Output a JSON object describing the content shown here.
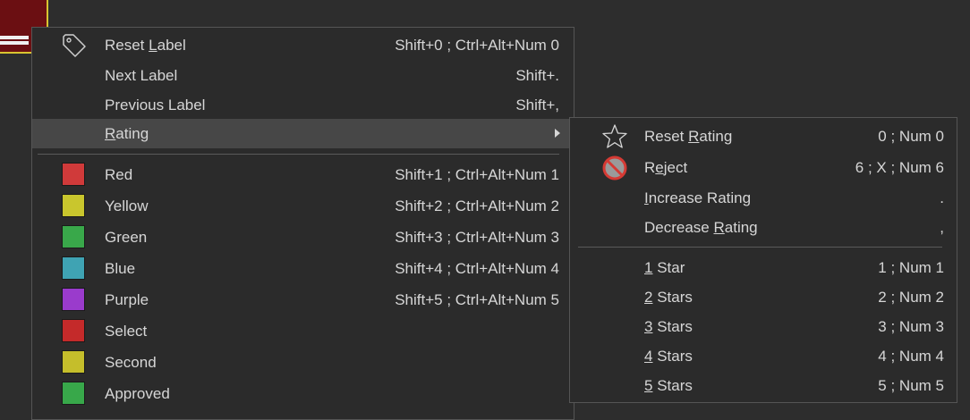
{
  "main_menu": {
    "items": [
      {
        "id": "reset-label",
        "pre": "Reset ",
        "u": "L",
        "post": "abel",
        "shortcut": "Shift+0 ; Ctrl+Alt+Num 0",
        "icon": "tag-icon"
      },
      {
        "id": "next-label",
        "pre": "Next Label",
        "u": "",
        "post": "",
        "shortcut": "Shift+."
      },
      {
        "id": "previous-label",
        "pre": "Previous Label",
        "u": "",
        "post": "",
        "shortcut": "Shift+,"
      },
      {
        "id": "rating",
        "pre": "",
        "u": "R",
        "post": "ating",
        "shortcut": "",
        "submenu": true
      }
    ],
    "labels": [
      {
        "name": "Red",
        "shortcut": "Shift+1 ; Ctrl+Alt+Num 1",
        "color": "#d03a3a"
      },
      {
        "name": "Yellow",
        "shortcut": "Shift+2 ; Ctrl+Alt+Num 2",
        "color": "#c9c62d"
      },
      {
        "name": "Green",
        "shortcut": "Shift+3 ; Ctrl+Alt+Num 3",
        "color": "#39a84a"
      },
      {
        "name": "Blue",
        "shortcut": "Shift+4 ; Ctrl+Alt+Num 4",
        "color": "#3fa3b3"
      },
      {
        "name": "Purple",
        "shortcut": "Shift+5 ; Ctrl+Alt+Num 5",
        "color": "#9a3bcc"
      },
      {
        "name": "Select",
        "shortcut": "",
        "color": "#c42a2a"
      },
      {
        "name": "Second",
        "shortcut": "",
        "color": "#c5be2b"
      },
      {
        "name": "Approved",
        "shortcut": "",
        "color": "#38a84a"
      }
    ]
  },
  "sub_menu": {
    "items": [
      {
        "id": "reset-rating",
        "pre": "Reset ",
        "u": "R",
        "post": "ating",
        "shortcut": "0 ; Num 0",
        "icon": "star-outline-icon"
      },
      {
        "id": "reject",
        "pre": "R",
        "u": "e",
        "post": "ject",
        "shortcut": "6 ; X ; Num 6",
        "icon": "reject-icon"
      },
      {
        "id": "increase-rating",
        "pre": "",
        "u": "I",
        "post": "ncrease Rating",
        "shortcut": "."
      },
      {
        "id": "decrease-rating",
        "pre": "Decrease ",
        "u": "R",
        "post": "ating",
        "shortcut": ","
      }
    ],
    "stars": [
      {
        "id": "1-star",
        "u": "1",
        "post": " Star",
        "shortcut": "1 ; Num 1"
      },
      {
        "id": "2-stars",
        "u": "2",
        "post": " Stars",
        "shortcut": "2 ; Num 2"
      },
      {
        "id": "3-stars",
        "u": "3",
        "post": " Stars",
        "shortcut": "3 ; Num 3"
      },
      {
        "id": "4-stars",
        "u": "4",
        "post": " Stars",
        "shortcut": "4 ; Num 4"
      },
      {
        "id": "5-stars",
        "u": "5",
        "post": " Stars",
        "shortcut": "5 ; Num 5"
      }
    ]
  }
}
